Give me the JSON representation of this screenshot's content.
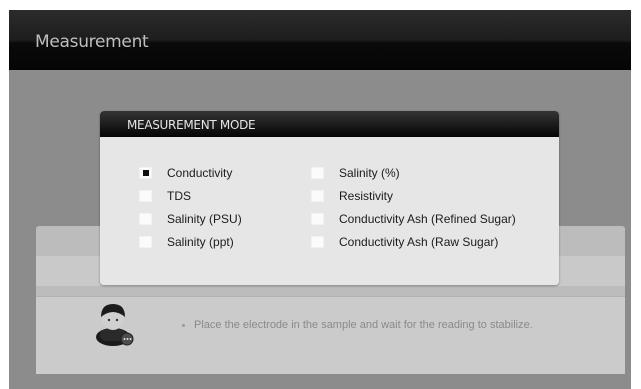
{
  "app": {
    "title": "Measurement"
  },
  "dialog": {
    "title": "MEASUREMENT MODE",
    "options_left": [
      {
        "label": "Conductivity",
        "checked": true
      },
      {
        "label": "TDS",
        "checked": false
      },
      {
        "label": "Salinity (PSU)",
        "checked": false
      },
      {
        "label": "Salinity (ppt)",
        "checked": false
      }
    ],
    "options_right": [
      {
        "label": "Salinity (%)",
        "checked": false
      },
      {
        "label": "Resistivity",
        "checked": false
      },
      {
        "label": "Conductivity Ash (Refined Sugar)",
        "checked": false
      },
      {
        "label": "Conductivity Ash (Raw Sugar)",
        "checked": false
      }
    ]
  },
  "status": {
    "message": "Place the electrode in the sample and wait for the reading to stabilize."
  },
  "icons": {
    "operator": "operator-avatar-icon",
    "bullet": "bullet-dot-icon"
  }
}
